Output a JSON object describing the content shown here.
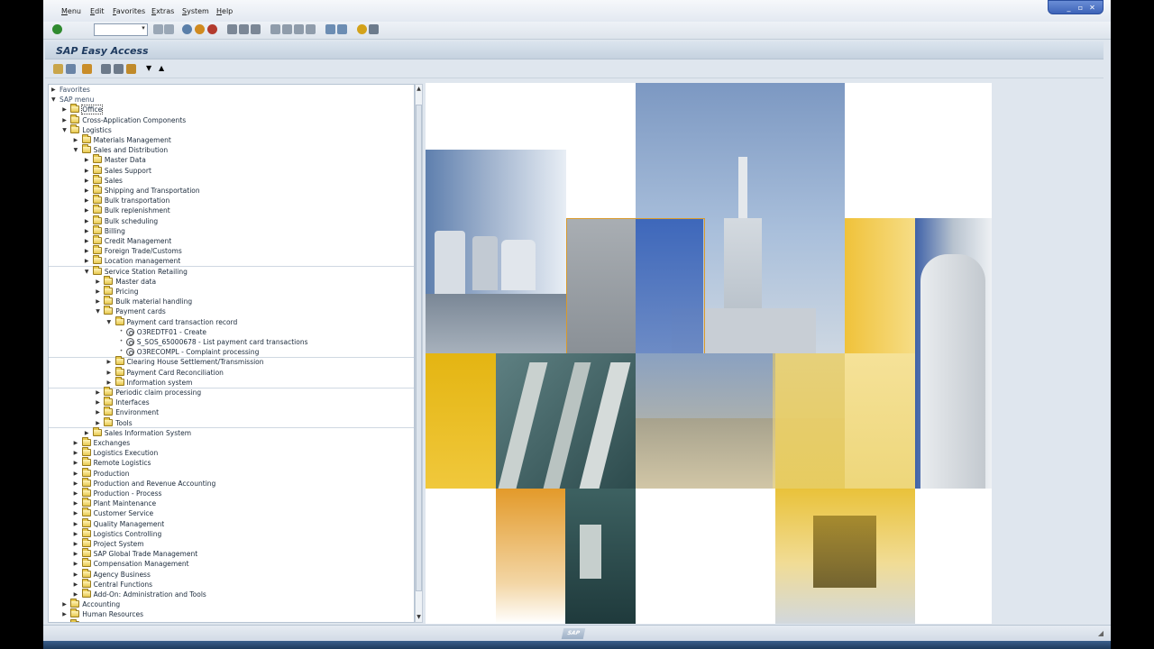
{
  "menu": [
    "Menu",
    "Edit",
    "Favorites",
    "Extras",
    "System",
    "Help"
  ],
  "title": "SAP Easy Access",
  "window_controls": [
    "_",
    "▫",
    "✕"
  ],
  "tree": [
    {
      "label": "Favorites",
      "level": 0,
      "state": "collapsed",
      "kind": "plain"
    },
    {
      "label": "SAP menu",
      "level": 0,
      "state": "expanded",
      "kind": "plain"
    },
    {
      "label": "Office",
      "level": 1,
      "state": "collapsed",
      "kind": "folder",
      "selected": true
    },
    {
      "label": "Cross-Application Components",
      "level": 1,
      "state": "collapsed",
      "kind": "folder"
    },
    {
      "label": "Logistics",
      "level": 1,
      "state": "expanded",
      "kind": "folder"
    },
    {
      "label": "Materials Management",
      "level": 2,
      "state": "collapsed",
      "kind": "folder"
    },
    {
      "label": "Sales and Distribution",
      "level": 2,
      "state": "expanded",
      "kind": "folder"
    },
    {
      "label": "Master Data",
      "level": 3,
      "state": "collapsed",
      "kind": "folder"
    },
    {
      "label": "Sales Support",
      "level": 3,
      "state": "collapsed",
      "kind": "folder"
    },
    {
      "label": "Sales",
      "level": 3,
      "state": "collapsed",
      "kind": "folder"
    },
    {
      "label": "Shipping and Transportation",
      "level": 3,
      "state": "collapsed",
      "kind": "folder"
    },
    {
      "label": "Bulk transportation",
      "level": 3,
      "state": "collapsed",
      "kind": "folder"
    },
    {
      "label": "Bulk replenishment",
      "level": 3,
      "state": "collapsed",
      "kind": "folder"
    },
    {
      "label": "Bulk scheduling",
      "level": 3,
      "state": "collapsed",
      "kind": "folder"
    },
    {
      "label": "Billing",
      "level": 3,
      "state": "collapsed",
      "kind": "folder"
    },
    {
      "label": "Credit Management",
      "level": 3,
      "state": "collapsed",
      "kind": "folder"
    },
    {
      "label": "Foreign Trade/Customs",
      "level": 3,
      "state": "collapsed",
      "kind": "folder"
    },
    {
      "label": "Location management",
      "level": 3,
      "state": "collapsed",
      "kind": "folder"
    },
    {
      "label": "Service Station Retailing",
      "level": 3,
      "state": "expanded",
      "kind": "folder"
    },
    {
      "label": "Master data",
      "level": 4,
      "state": "collapsed",
      "kind": "folder"
    },
    {
      "label": "Pricing",
      "level": 4,
      "state": "collapsed",
      "kind": "folder"
    },
    {
      "label": "Bulk material handling",
      "level": 4,
      "state": "collapsed",
      "kind": "folder"
    },
    {
      "label": "Payment cards",
      "level": 4,
      "state": "expanded",
      "kind": "folder"
    },
    {
      "label": "Payment card transaction record",
      "level": 5,
      "state": "expanded",
      "kind": "folder"
    },
    {
      "label": "O3REDTF01 - Create",
      "level": 6,
      "state": "leaf",
      "kind": "tcode"
    },
    {
      "label": "S_SOS_65000678 - List payment card transactions",
      "level": 6,
      "state": "leaf",
      "kind": "tcode"
    },
    {
      "label": "O3RECOMPL - Complaint processing",
      "level": 6,
      "state": "leaf",
      "kind": "tcode"
    },
    {
      "label": "Clearing House Settlement/Transmission",
      "level": 5,
      "state": "collapsed",
      "kind": "folder"
    },
    {
      "label": "Payment Card Reconciliation",
      "level": 5,
      "state": "collapsed",
      "kind": "folder"
    },
    {
      "label": "Information system",
      "level": 5,
      "state": "collapsed",
      "kind": "folder"
    },
    {
      "label": "Periodic claim processing",
      "level": 4,
      "state": "collapsed",
      "kind": "folder"
    },
    {
      "label": "Interfaces",
      "level": 4,
      "state": "collapsed",
      "kind": "folder"
    },
    {
      "label": "Environment",
      "level": 4,
      "state": "collapsed",
      "kind": "folder"
    },
    {
      "label": "Tools",
      "level": 4,
      "state": "collapsed",
      "kind": "folder"
    },
    {
      "label": "Sales Information System",
      "level": 3,
      "state": "collapsed",
      "kind": "folder"
    },
    {
      "label": "Exchanges",
      "level": 2,
      "state": "collapsed",
      "kind": "folder"
    },
    {
      "label": "Logistics Execution",
      "level": 2,
      "state": "collapsed",
      "kind": "folder"
    },
    {
      "label": "Remote Logistics",
      "level": 2,
      "state": "collapsed",
      "kind": "folder"
    },
    {
      "label": "Production",
      "level": 2,
      "state": "collapsed",
      "kind": "folder"
    },
    {
      "label": "Production and Revenue Accounting",
      "level": 2,
      "state": "collapsed",
      "kind": "folder"
    },
    {
      "label": "Production - Process",
      "level": 2,
      "state": "collapsed",
      "kind": "folder"
    },
    {
      "label": "Plant Maintenance",
      "level": 2,
      "state": "collapsed",
      "kind": "folder"
    },
    {
      "label": "Customer Service",
      "level": 2,
      "state": "collapsed",
      "kind": "folder"
    },
    {
      "label": "Quality Management",
      "level": 2,
      "state": "collapsed",
      "kind": "folder"
    },
    {
      "label": "Logistics Controlling",
      "level": 2,
      "state": "collapsed",
      "kind": "folder"
    },
    {
      "label": "Project System",
      "level": 2,
      "state": "collapsed",
      "kind": "folder"
    },
    {
      "label": "SAP Global Trade Management",
      "level": 2,
      "state": "collapsed",
      "kind": "folder"
    },
    {
      "label": "Compensation Management",
      "level": 2,
      "state": "collapsed",
      "kind": "folder"
    },
    {
      "label": "Agency Business",
      "level": 2,
      "state": "collapsed",
      "kind": "folder"
    },
    {
      "label": "Central Functions",
      "level": 2,
      "state": "collapsed",
      "kind": "folder"
    },
    {
      "label": "Add-On: Administration and Tools",
      "level": 2,
      "state": "collapsed",
      "kind": "folder"
    },
    {
      "label": "Accounting",
      "level": 1,
      "state": "collapsed",
      "kind": "folder"
    },
    {
      "label": "Human Resources",
      "level": 1,
      "state": "collapsed",
      "kind": "folder"
    },
    {
      "label": "Information Systems",
      "level": 1,
      "state": "collapsed",
      "kind": "folder"
    }
  ],
  "footer_logo": "SAP",
  "colors": {
    "accent": "#1e3a5f",
    "tile_yellow": "#e9bf1a",
    "tile_blue": "#3f62a8",
    "tile_orange": "#e39a2a"
  }
}
